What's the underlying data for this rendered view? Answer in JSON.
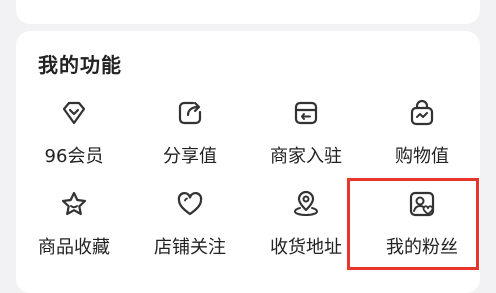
{
  "section": {
    "title": "我的功能"
  },
  "functions": [
    {
      "label": "96会员",
      "icon": "diamond-icon"
    },
    {
      "label": "分享值",
      "icon": "share-icon"
    },
    {
      "label": "商家入驻",
      "icon": "store-icon"
    },
    {
      "label": "购物值",
      "icon": "shopping-bag-icon"
    },
    {
      "label": "商品收藏",
      "icon": "star-icon"
    },
    {
      "label": "店铺关注",
      "icon": "heart-icon"
    },
    {
      "label": "收货地址",
      "icon": "location-pin-icon"
    },
    {
      "label": "我的粉丝",
      "icon": "user-heart-icon"
    }
  ],
  "colors": {
    "highlight": "#e8362a",
    "background": "#f2f2f4",
    "card": "#ffffff",
    "icon": "#333333"
  }
}
